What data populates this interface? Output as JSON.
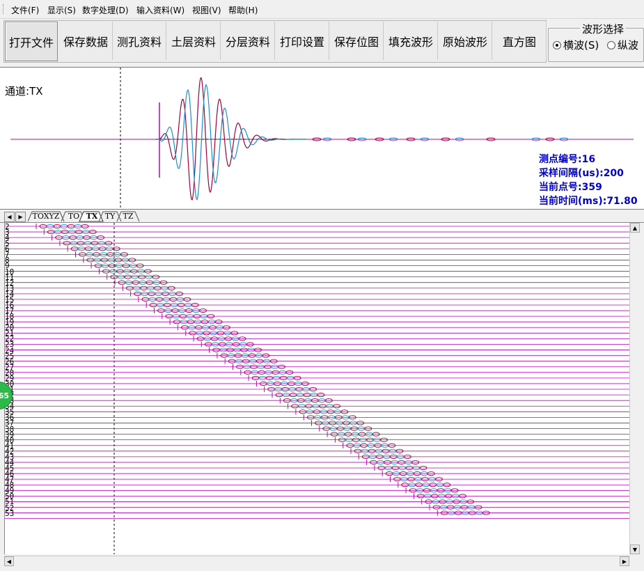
{
  "menu": [
    "文件(F)",
    "显示(S)",
    "数字处理(D)",
    "输入资料(W)",
    "视图(V)",
    "帮助(H)"
  ],
  "toolbar": [
    "打开文件",
    "保存数据",
    "测孔资料",
    "土层资料",
    "分层资料",
    "打印设置",
    "保存位图",
    "填充波形",
    "原始波形",
    "直方图"
  ],
  "wave_select": {
    "title": "波形选择",
    "options": [
      {
        "label": "横波(S)",
        "selected": true
      },
      {
        "label": "纵波",
        "selected": false
      }
    ]
  },
  "channel": {
    "label": "通道:TX"
  },
  "info": {
    "point_no": "测点编号:16",
    "interval": "采样间隔(us):200",
    "current_point": "当前点号:359",
    "current_time": "当前时间(ms):71.80"
  },
  "tabs": [
    {
      "label": "TOXYZ",
      "active": false
    },
    {
      "label": "TO",
      "active": false
    },
    {
      "label": "TX",
      "active": true
    },
    {
      "label": "TY",
      "active": false
    },
    {
      "label": "TZ",
      "active": false
    }
  ],
  "trace_numbers": [
    "2",
    "3",
    "4",
    "5",
    "6",
    "7",
    "8",
    "9",
    "10",
    "11",
    "12",
    "13",
    "14",
    "15",
    "16",
    "17",
    "18",
    "19",
    "20",
    "21",
    "22",
    "23",
    "24",
    "25",
    "26",
    "27",
    "28",
    "29",
    "30",
    "31",
    "32",
    "33",
    "34",
    "35",
    "36",
    "37",
    "38",
    "39",
    "40",
    "41",
    "42",
    "43",
    "44",
    "45",
    "46",
    "47",
    "48",
    "49",
    "50",
    "51",
    "52",
    "53"
  ],
  "badge": "65",
  "colors": {
    "trace_line": "#c000c0",
    "wave_blue": "#1b8fd1",
    "wave_red": "#a0003c",
    "info_text": "#0000cc"
  }
}
